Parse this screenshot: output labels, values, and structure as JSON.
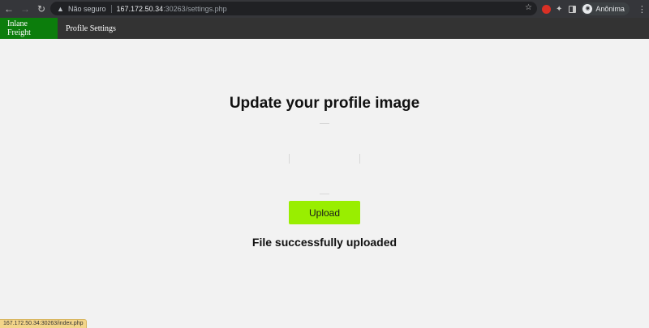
{
  "browser": {
    "security_label": "Não seguro",
    "url_host": "167.172.50.34",
    "url_rest": ":30263/settings.php",
    "profile_label": "Anônima",
    "status_link": "167.172.50.34:30263/index.php",
    "icons": [
      "back-arrow-icon",
      "forward-arrow-icon",
      "reload-icon",
      "warning-icon",
      "star-icon",
      "extension-puzzle-icon",
      "side-panel-icon",
      "incognito-icon",
      "menu-dots-icon"
    ]
  },
  "site_nav": {
    "brand": "Inlane Freight",
    "items": [
      {
        "label": "Profile Settings"
      }
    ],
    "brand_color": "#0c7d0c"
  },
  "main": {
    "heading": "Update your profile image",
    "upload_label": "Upload",
    "status": "File successfully uploaded",
    "button_color": "#99ee00"
  }
}
